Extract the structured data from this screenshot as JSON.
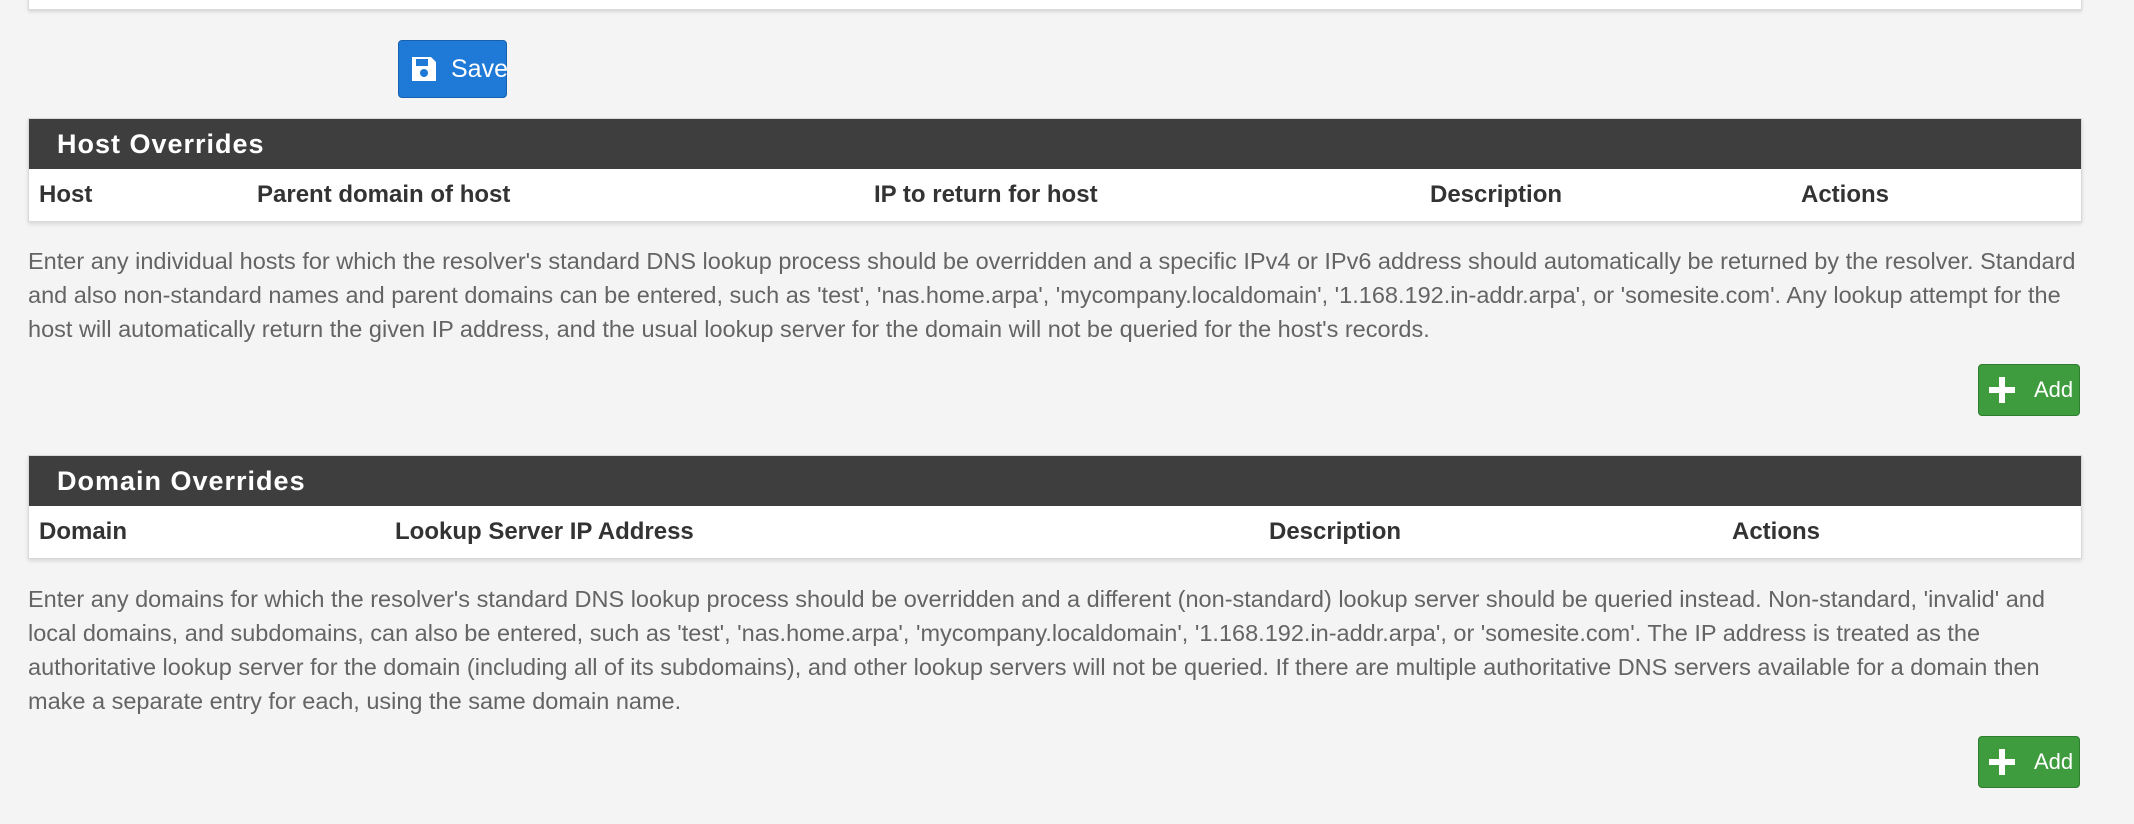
{
  "save_button": {
    "label": "Save",
    "icon": "floppy-disk-icon"
  },
  "host_overrides": {
    "title": "Host Overrides",
    "columns": [
      "Host",
      "Parent domain of host",
      "IP to return for host",
      "Description",
      "Actions"
    ],
    "help_text": "Enter any individual hosts for which the resolver's standard DNS lookup process should be overridden and a specific IPv4 or IPv6 address should automatically be returned by the resolver. Standard and also non-standard names and parent domains can be entered, such as 'test', 'nas.home.arpa', 'mycompany.localdomain', '1.168.192.in-addr.arpa', or 'somesite.com'. Any lookup attempt for the host will automatically return the given IP address, and the usual lookup server for the domain will not be queried for the host's records.",
    "add_label": "Add"
  },
  "domain_overrides": {
    "title": "Domain Overrides",
    "columns": [
      "Domain",
      "Lookup Server IP Address",
      "Description",
      "Actions"
    ],
    "help_text": "Enter any domains for which the resolver's standard DNS lookup process should be overridden and a different (non-standard) lookup server should be queried instead. Non-standard, 'invalid' and local domains, and subdomains, can also be entered, such as 'test', 'nas.home.arpa', 'mycompany.localdomain', '1.168.192.in-addr.arpa', or 'somesite.com'. The IP address is treated as the authoritative lookup server for the domain (including all of its subdomains), and other lookup servers will not be queried. If there are multiple authoritative DNS servers available for a domain then make a separate entry for each, using the same domain name.",
    "add_label": "Add"
  },
  "colors": {
    "page_bg": "#f4f4f4",
    "panel_heading_bg": "#3e3e3e",
    "save_button_bg": "#1e7ad6",
    "add_button_bg": "#3e9c3e",
    "help_text": "#646464"
  }
}
